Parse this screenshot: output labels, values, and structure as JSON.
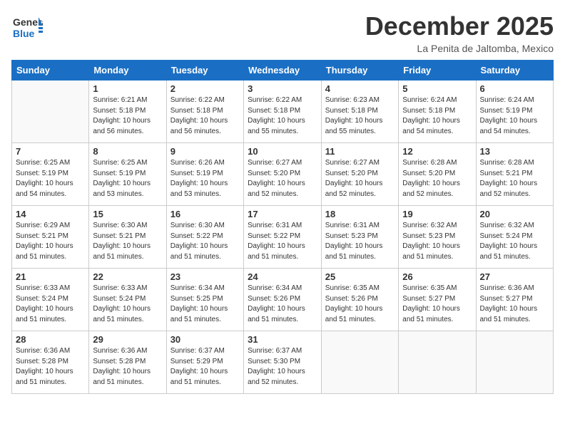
{
  "header": {
    "logo_general": "General",
    "logo_blue": "Blue",
    "month_title": "December 2025",
    "location": "La Penita de Jaltomba, Mexico"
  },
  "columns": [
    "Sunday",
    "Monday",
    "Tuesday",
    "Wednesday",
    "Thursday",
    "Friday",
    "Saturday"
  ],
  "weeks": [
    [
      {
        "day": "",
        "info": ""
      },
      {
        "day": "1",
        "info": "Sunrise: 6:21 AM\nSunset: 5:18 PM\nDaylight: 10 hours\nand 56 minutes."
      },
      {
        "day": "2",
        "info": "Sunrise: 6:22 AM\nSunset: 5:18 PM\nDaylight: 10 hours\nand 56 minutes."
      },
      {
        "day": "3",
        "info": "Sunrise: 6:22 AM\nSunset: 5:18 PM\nDaylight: 10 hours\nand 55 minutes."
      },
      {
        "day": "4",
        "info": "Sunrise: 6:23 AM\nSunset: 5:18 PM\nDaylight: 10 hours\nand 55 minutes."
      },
      {
        "day": "5",
        "info": "Sunrise: 6:24 AM\nSunset: 5:18 PM\nDaylight: 10 hours\nand 54 minutes."
      },
      {
        "day": "6",
        "info": "Sunrise: 6:24 AM\nSunset: 5:19 PM\nDaylight: 10 hours\nand 54 minutes."
      }
    ],
    [
      {
        "day": "7",
        "info": "Sunrise: 6:25 AM\nSunset: 5:19 PM\nDaylight: 10 hours\nand 54 minutes."
      },
      {
        "day": "8",
        "info": "Sunrise: 6:25 AM\nSunset: 5:19 PM\nDaylight: 10 hours\nand 53 minutes."
      },
      {
        "day": "9",
        "info": "Sunrise: 6:26 AM\nSunset: 5:19 PM\nDaylight: 10 hours\nand 53 minutes."
      },
      {
        "day": "10",
        "info": "Sunrise: 6:27 AM\nSunset: 5:20 PM\nDaylight: 10 hours\nand 52 minutes."
      },
      {
        "day": "11",
        "info": "Sunrise: 6:27 AM\nSunset: 5:20 PM\nDaylight: 10 hours\nand 52 minutes."
      },
      {
        "day": "12",
        "info": "Sunrise: 6:28 AM\nSunset: 5:20 PM\nDaylight: 10 hours\nand 52 minutes."
      },
      {
        "day": "13",
        "info": "Sunrise: 6:28 AM\nSunset: 5:21 PM\nDaylight: 10 hours\nand 52 minutes."
      }
    ],
    [
      {
        "day": "14",
        "info": "Sunrise: 6:29 AM\nSunset: 5:21 PM\nDaylight: 10 hours\nand 51 minutes."
      },
      {
        "day": "15",
        "info": "Sunrise: 6:30 AM\nSunset: 5:21 PM\nDaylight: 10 hours\nand 51 minutes."
      },
      {
        "day": "16",
        "info": "Sunrise: 6:30 AM\nSunset: 5:22 PM\nDaylight: 10 hours\nand 51 minutes."
      },
      {
        "day": "17",
        "info": "Sunrise: 6:31 AM\nSunset: 5:22 PM\nDaylight: 10 hours\nand 51 minutes."
      },
      {
        "day": "18",
        "info": "Sunrise: 6:31 AM\nSunset: 5:23 PM\nDaylight: 10 hours\nand 51 minutes."
      },
      {
        "day": "19",
        "info": "Sunrise: 6:32 AM\nSunset: 5:23 PM\nDaylight: 10 hours\nand 51 minutes."
      },
      {
        "day": "20",
        "info": "Sunrise: 6:32 AM\nSunset: 5:24 PM\nDaylight: 10 hours\nand 51 minutes."
      }
    ],
    [
      {
        "day": "21",
        "info": "Sunrise: 6:33 AM\nSunset: 5:24 PM\nDaylight: 10 hours\nand 51 minutes."
      },
      {
        "day": "22",
        "info": "Sunrise: 6:33 AM\nSunset: 5:24 PM\nDaylight: 10 hours\nand 51 minutes."
      },
      {
        "day": "23",
        "info": "Sunrise: 6:34 AM\nSunset: 5:25 PM\nDaylight: 10 hours\nand 51 minutes."
      },
      {
        "day": "24",
        "info": "Sunrise: 6:34 AM\nSunset: 5:26 PM\nDaylight: 10 hours\nand 51 minutes."
      },
      {
        "day": "25",
        "info": "Sunrise: 6:35 AM\nSunset: 5:26 PM\nDaylight: 10 hours\nand 51 minutes."
      },
      {
        "day": "26",
        "info": "Sunrise: 6:35 AM\nSunset: 5:27 PM\nDaylight: 10 hours\nand 51 minutes."
      },
      {
        "day": "27",
        "info": "Sunrise: 6:36 AM\nSunset: 5:27 PM\nDaylight: 10 hours\nand 51 minutes."
      }
    ],
    [
      {
        "day": "28",
        "info": "Sunrise: 6:36 AM\nSunset: 5:28 PM\nDaylight: 10 hours\nand 51 minutes."
      },
      {
        "day": "29",
        "info": "Sunrise: 6:36 AM\nSunset: 5:28 PM\nDaylight: 10 hours\nand 51 minutes."
      },
      {
        "day": "30",
        "info": "Sunrise: 6:37 AM\nSunset: 5:29 PM\nDaylight: 10 hours\nand 51 minutes."
      },
      {
        "day": "31",
        "info": "Sunrise: 6:37 AM\nSunset: 5:30 PM\nDaylight: 10 hours\nand 52 minutes."
      },
      {
        "day": "",
        "info": ""
      },
      {
        "day": "",
        "info": ""
      },
      {
        "day": "",
        "info": ""
      }
    ]
  ]
}
